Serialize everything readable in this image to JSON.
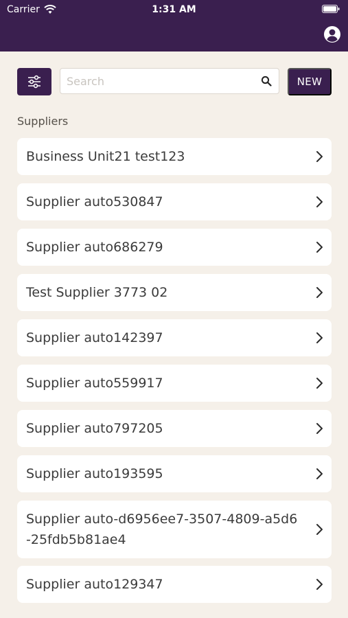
{
  "status_bar": {
    "carrier": "Carrier",
    "time": "1:31 AM"
  },
  "icons": {
    "wifi": "wifi-icon",
    "battery": "battery-icon",
    "account": "account-circle-icon",
    "filter": "sliders-icon",
    "search": "search-icon",
    "chevron": "chevron-right-icon"
  },
  "colors": {
    "header": "#3a1f4f",
    "background": "#f5f0e9",
    "card": "#ffffff",
    "accent": "#3a1f4f"
  },
  "toolbar": {
    "search_placeholder": "Search",
    "search_value": "",
    "new_label": "NEW"
  },
  "suppliers": {
    "section_title": "Suppliers",
    "items": [
      {
        "label": "Business Unit21 test123"
      },
      {
        "label": "Supplier auto530847"
      },
      {
        "label": "Supplier auto686279"
      },
      {
        "label": "Test Supplier 3773 02"
      },
      {
        "label": "Supplier auto142397"
      },
      {
        "label": "Supplier auto559917"
      },
      {
        "label": "Supplier auto797205"
      },
      {
        "label": "Supplier auto193595"
      },
      {
        "label": "Supplier auto-d6956ee7-3507-4809-a5d6-25fdb5b81ae4"
      },
      {
        "label": "Supplier auto129347"
      }
    ]
  }
}
